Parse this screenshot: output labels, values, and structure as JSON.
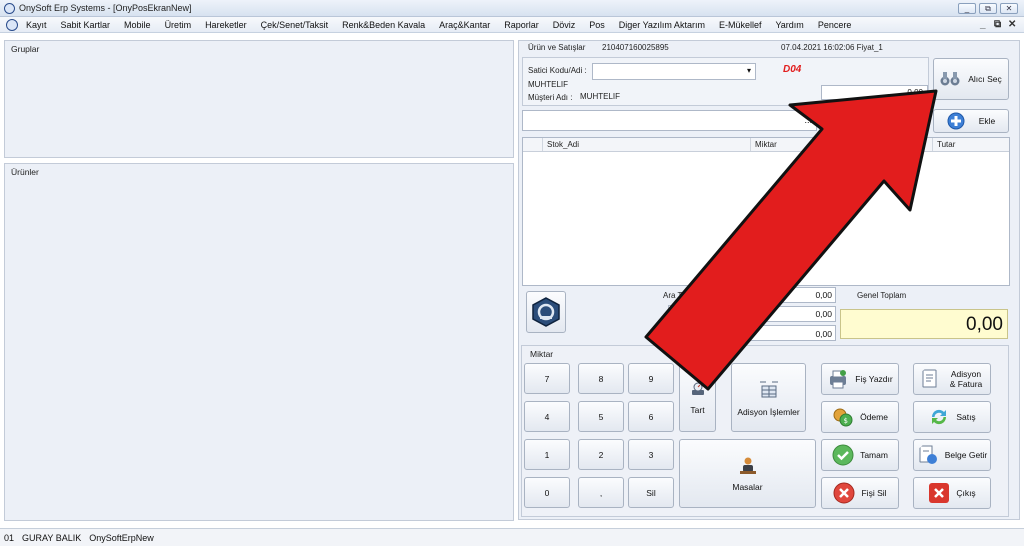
{
  "window": {
    "title": "OnySoft Erp Systems - [OnyPosEkranNew]",
    "minimize": "_",
    "restore": "⧉",
    "close": "✕",
    "mdi_min": "_",
    "mdi_restore": "⧉",
    "mdi_close": "✕"
  },
  "menu": [
    "Kayıt",
    "Sabit Kartlar",
    "Mobile",
    "Üretim",
    "Hareketler",
    "Çek/Senet/Taksit",
    "Renk&Beden Kavala",
    "Araç&Kantar",
    "Raporlar",
    "Döviz",
    "Pos",
    "Diger Yazılım Aktarım",
    "E-Mükellef",
    "Yardım",
    "Pencere"
  ],
  "left": {
    "groups_title": "Gruplar",
    "products_title": "Ürünler"
  },
  "sale": {
    "header_label": "Ürün ve Satışlar",
    "receipt_no": "210407160025895",
    "datetime_price": "07.04.2021 16:02:06 Fiyat_1",
    "seller_label": "Satici Kodu/Adi :",
    "seller_value": "",
    "seller_code": "MUHTELIF",
    "customer_label": "Müşteri Adı :",
    "customer_value": "MUHTELIF",
    "code_badge": "D04",
    "balance": "0,00",
    "buyer_button": "Alıcı Seç",
    "product_input": "",
    "ellipsis": "...",
    "qty_input": "",
    "add_button": "Ekle"
  },
  "grid": {
    "columns": [
      "Stok_Adi",
      "Miktar",
      "B",
      "Tutar"
    ]
  },
  "totals": {
    "subtotal_label": "Ara Toplam",
    "subtotal": "0,00",
    "row2": "0,00",
    "row3": "0,00",
    "grand_label": "Genel Toplam",
    "grand_total": "0,00"
  },
  "keypad": {
    "title": "Miktar",
    "keys": [
      "7",
      "8",
      "9",
      "4",
      "5",
      "6",
      "1",
      "2",
      "3",
      "0",
      ",",
      "Sil"
    ],
    "tart": "Tart",
    "adisyon_islemler": "Adisyon İşlemler",
    "masalar": "Masalar"
  },
  "actions": {
    "fis_yazdir": "Fiş Yazdır",
    "adisyon_fatura": "Adisyon & Fatura",
    "odeme": "Ödeme",
    "satis": "Satış",
    "tamam": "Tamam",
    "belge_getir": "Belge Getir",
    "fisi_sil": "Fişi Sil",
    "cikis": "Çıkış"
  },
  "status": {
    "code": "01",
    "user": "GURAY BALIK",
    "db": "OnySoftErpNew"
  },
  "colors": {
    "accent": "#e21d1d",
    "grand_total_bg": "#fffcd0"
  }
}
